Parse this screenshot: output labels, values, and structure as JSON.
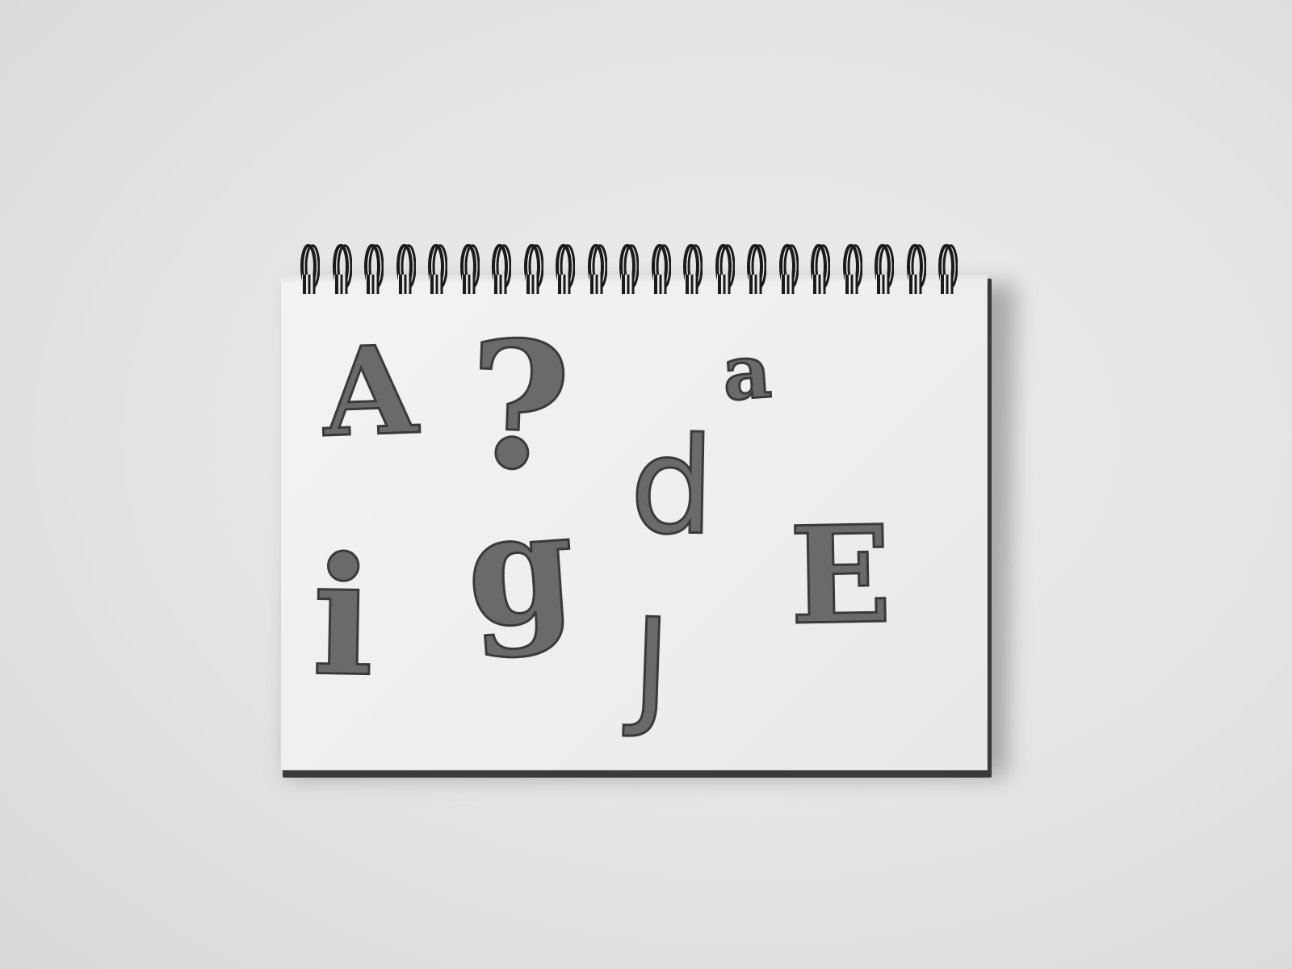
{
  "scene": {
    "subject": "spiral-sketchbook",
    "coil_count": 21,
    "colors": {
      "background": "#e6e6e6",
      "paper": "#efefef",
      "pencil_fill": "#6a6a6a",
      "pencil_outline": "#3a3a3a",
      "coil": "#1a1a1a"
    }
  },
  "letters": {
    "a_upper": "A",
    "question": "?",
    "a_lower": "a",
    "d_lower": "d",
    "i_lower": "i",
    "g_lower": "g",
    "j_upper": "J",
    "e_upper": "E"
  }
}
